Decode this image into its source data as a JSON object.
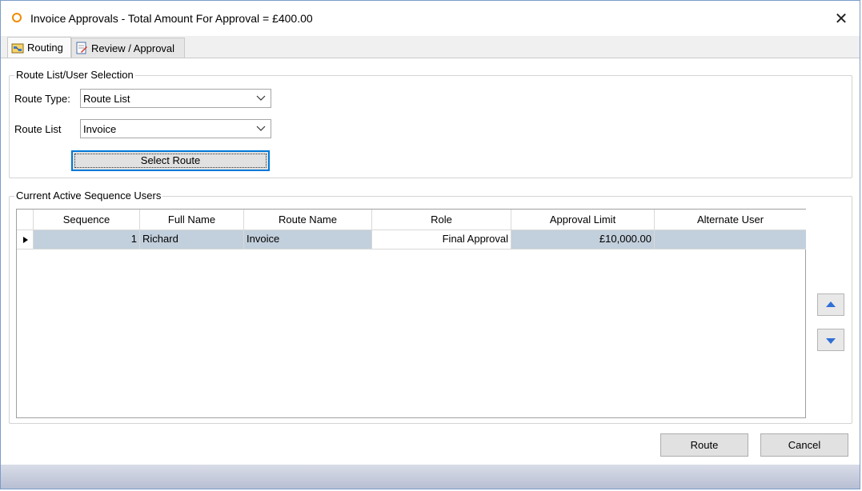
{
  "window": {
    "title": "Invoice Approvals - Total Amount For Approval = £400.00"
  },
  "tabs": [
    {
      "label": "Routing",
      "icon": "routing-icon",
      "active": true
    },
    {
      "label": "Review / Approval",
      "icon": "review-approval-icon",
      "active": false
    }
  ],
  "route_group": {
    "title": "Route List/User Selection",
    "route_type_label": "Route Type:",
    "route_type_value": "Route List",
    "route_list_label": "Route List",
    "route_list_value": "Invoice",
    "select_route_label": "Select Route"
  },
  "users_group": {
    "title": "Current Active Sequence Users",
    "columns": [
      "Sequence",
      "Full Name",
      "Route Name",
      "Role",
      "Approval Limit",
      "Alternate User"
    ],
    "rows": [
      {
        "sequence": "1",
        "full_name": "Richard",
        "route_name": "Invoice",
        "role": "Final Approval",
        "approval_limit": "£10,000.00",
        "alternate_user": ""
      }
    ]
  },
  "buttons": {
    "route": "Route",
    "cancel": "Cancel"
  },
  "colors": {
    "title_icon": "#f08a00",
    "selection": "#c2cfdc",
    "focus_border": "#0078d7",
    "arrow_blue": "#2f6fd6"
  }
}
